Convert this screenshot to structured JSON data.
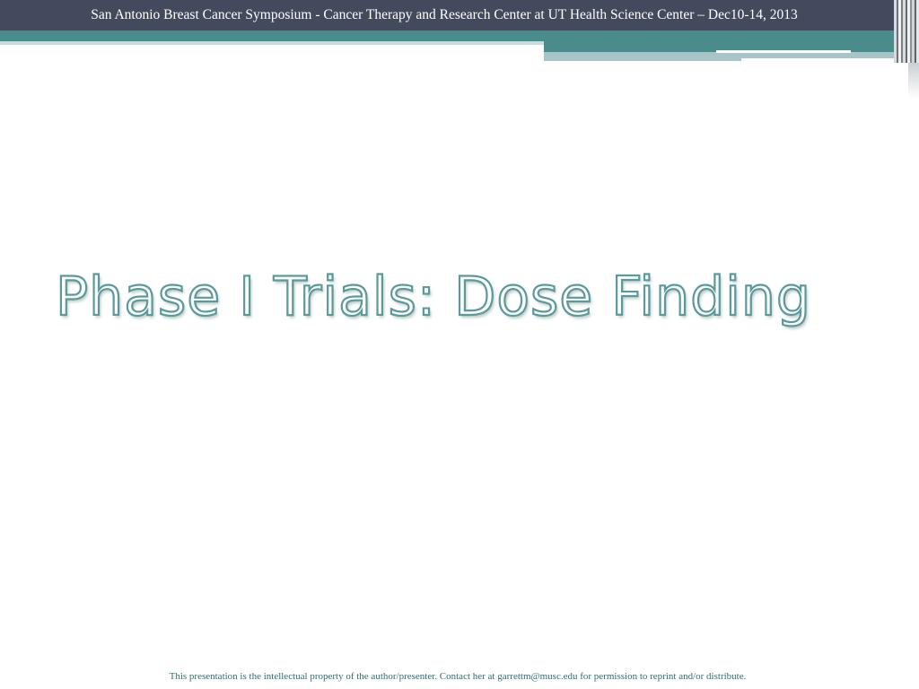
{
  "header": {
    "text": "San Antonio Breast Cancer Symposium - Cancer Therapy and Research Center at UT Health Science Center – Dec10-14, 2013"
  },
  "slide": {
    "title": "Phase I Trials: Dose Finding"
  },
  "footer": {
    "text": "This presentation is the intellectual property of the author/presenter.  Contact her at garrettm@musc.edu for permission to reprint and/or distribute."
  },
  "colors": {
    "header_background": "#434a5d",
    "accent_teal": "#4a8b8b",
    "title_outline": "#5a9a9a",
    "footer_text": "#2f6f73"
  }
}
